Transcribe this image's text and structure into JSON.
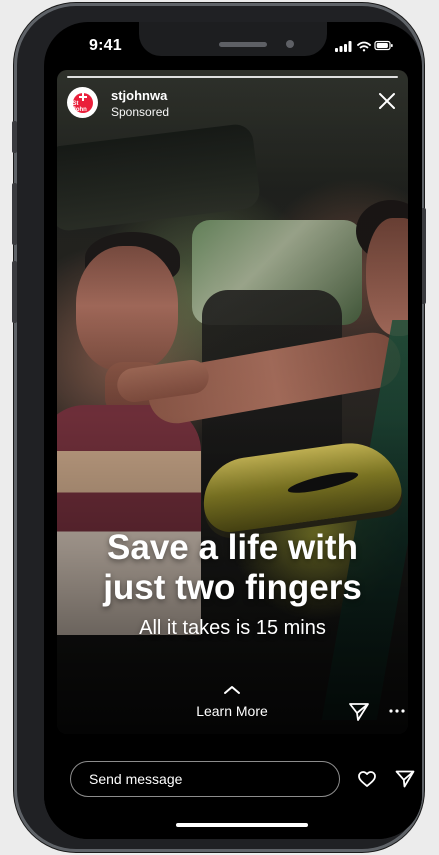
{
  "status_bar": {
    "time": "9:41",
    "icons": [
      "signal-icon",
      "wifi-icon",
      "battery-icon"
    ]
  },
  "story": {
    "progress": 1.0,
    "account_name": "stjohnwa",
    "account_meta": "Sponsored",
    "brand_mark": "St John",
    "headline": "Save a life with\njust two fingers",
    "subheadline": "All it takes is 15 mins",
    "cta_label": "Learn More",
    "icons": {
      "close": "close-icon",
      "cta": "chevron-up-icon",
      "share": "send-icon",
      "more": "more-horizontal-icon"
    }
  },
  "footer": {
    "message_placeholder": "Send message",
    "icons": {
      "like": "heart-icon",
      "send": "send-icon"
    }
  },
  "colors": {
    "brand_red": "#ea1f3b",
    "frame": "#202124",
    "screen": "#000000",
    "text": "#ffffff"
  }
}
